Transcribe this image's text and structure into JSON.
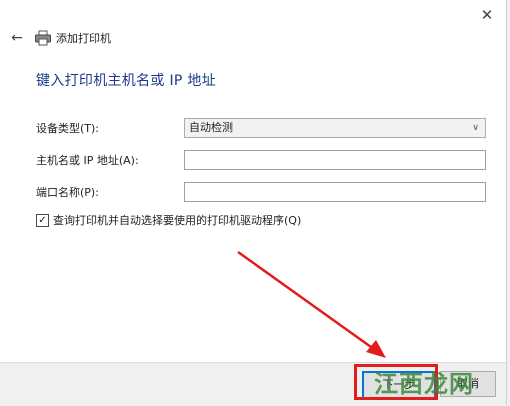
{
  "window": {
    "close_glyph": "✕",
    "back_glyph": "←",
    "title": "添加打印机"
  },
  "heading": "键入打印机主机名或 IP 地址",
  "fields": {
    "device_type_label": "设备类型(T):",
    "device_type_value": "自动检测",
    "hostname_label": "主机名或 IP 地址(A):",
    "hostname_value": "",
    "port_label": "端口名称(P):",
    "port_value": ""
  },
  "checkbox": {
    "checked": true,
    "label": "查询打印机并自动选择要使用的打印机驱动程序(Q)"
  },
  "buttons": {
    "next": "下一步",
    "cancel": "取消"
  },
  "watermark": "江西龙网",
  "colors": {
    "accent": "#0078d7",
    "heading": "#1a3a8a",
    "annotation": "#e11d1d"
  }
}
